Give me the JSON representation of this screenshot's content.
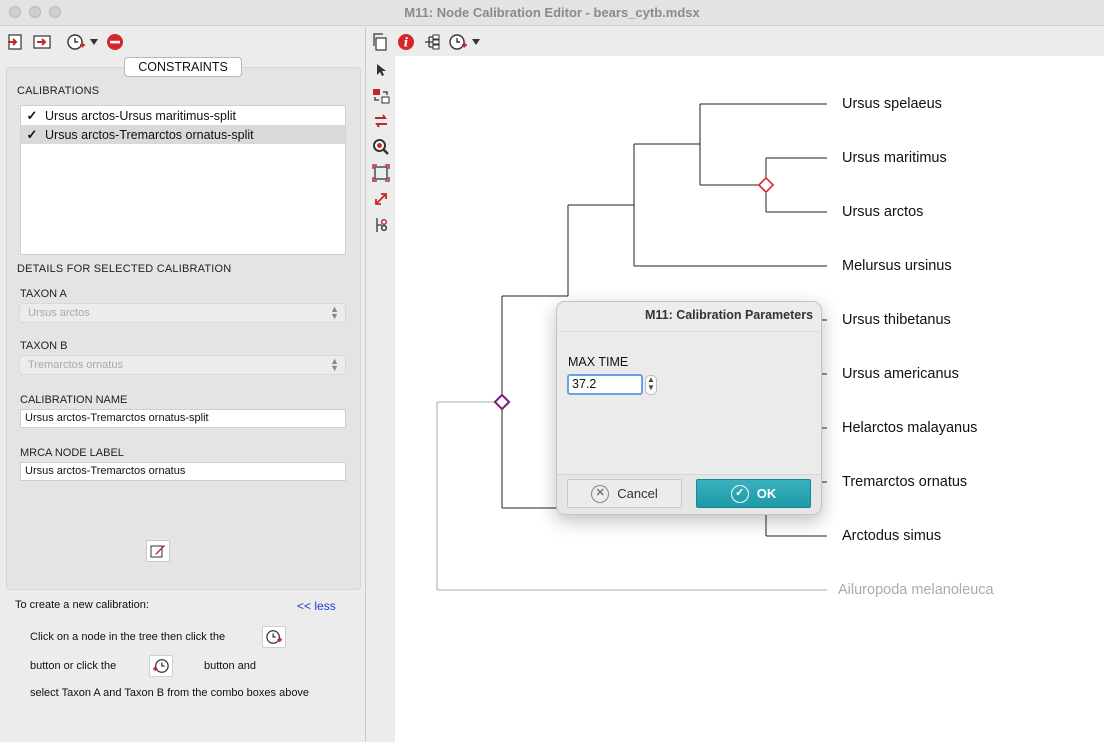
{
  "window": {
    "title": "M11: Node Calibration Editor - bears_cytb.mdsx"
  },
  "left": {
    "tab_label": "CONSTRAINTS",
    "calibrations_label": "CALIBRATIONS",
    "calibrations": [
      {
        "label": "Ursus arctos-Ursus maritimus-split",
        "checked": true,
        "selected": false
      },
      {
        "label": "Ursus arctos-Tremarctos ornatus-split",
        "checked": true,
        "selected": true
      }
    ],
    "details_label": "DETAILS FOR SELECTED CALIBRATION",
    "taxon_a_label": "TAXON A",
    "taxon_a_value": "Ursus arctos",
    "taxon_b_label": "TAXON B",
    "taxon_b_value": "Tremarctos ornatus",
    "calibration_name_label": "CALIBRATION NAME",
    "calibration_name_value": "Ursus arctos-Tremarctos ornatus-split",
    "mrca_label": "MRCA NODE LABEL",
    "mrca_value": "Ursus arctos-Tremarctos ornatus",
    "help_title": "To create a new calibration:",
    "less_link": "<< less",
    "help_line1": "Click on a node in the tree then click the",
    "help_line2a": "button or click the",
    "help_line2b": "button and",
    "help_line3": "select Taxon A and Taxon B from the combo boxes above"
  },
  "tree": {
    "taxa": [
      {
        "name": "Ursus spelaeus",
        "dim": false
      },
      {
        "name": "Ursus maritimus",
        "dim": false
      },
      {
        "name": "Ursus arctos",
        "dim": false
      },
      {
        "name": "Melursus ursinus",
        "dim": false
      },
      {
        "name": "Ursus thibetanus",
        "dim": false
      },
      {
        "name": "Ursus americanus",
        "dim": false
      },
      {
        "name": "Helarctos malayanus",
        "dim": false
      },
      {
        "name": "Tremarctos ornatus",
        "dim": false
      },
      {
        "name": "Arctodus simus",
        "dim": false
      },
      {
        "name": "Ailuropoda melanoleuca",
        "dim": true
      }
    ],
    "colors": {
      "calibration_node_1": "#e0202a",
      "calibration_node_2": "#7a1a7a"
    }
  },
  "dialog": {
    "title": "M11: Calibration Parameters",
    "max_time_label": "MAX TIME",
    "max_time_value": "37.2",
    "cancel_label": "Cancel",
    "ok_label": "OK",
    "ok_color": "#22a2b0"
  }
}
